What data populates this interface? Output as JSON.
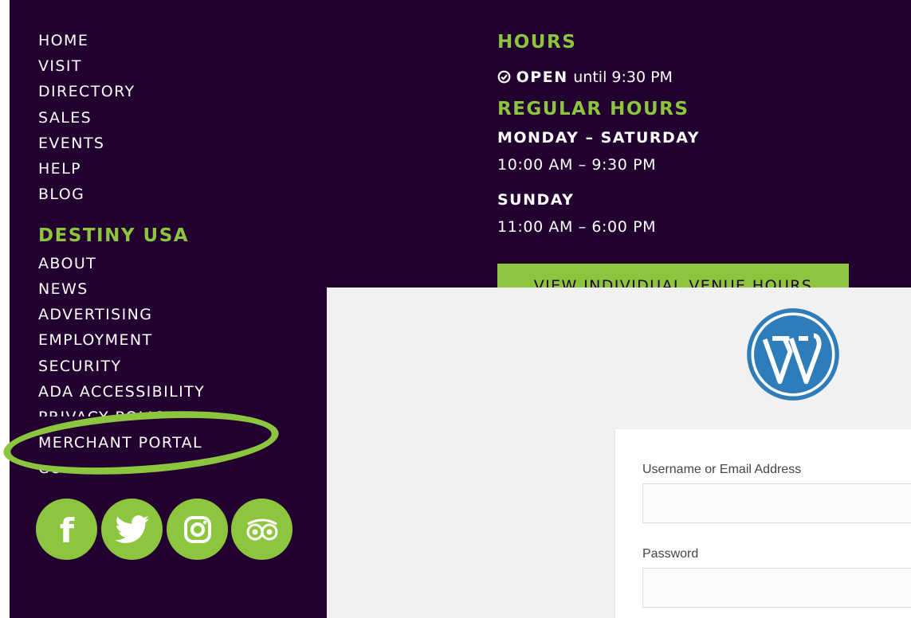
{
  "nav": {
    "main_links": [
      "HOME",
      "VISIT",
      "DIRECTORY",
      "SALES",
      "EVENTS",
      "HELP",
      "BLOG"
    ],
    "section_title": "DESTINY USA",
    "section_links": [
      "ABOUT",
      "NEWS",
      "ADVERTISING",
      "EMPLOYMENT",
      "SECURITY",
      "ADA ACCESSIBILITY"
    ],
    "partially_hidden_link": "PRIVACY POLICY",
    "highlighted_link": "MERCHANT PORTAL",
    "community_link": "COMMUNITY"
  },
  "social": [
    {
      "name": "facebook-icon",
      "glyph": "f"
    },
    {
      "name": "twitter-icon",
      "glyph": "twitter"
    },
    {
      "name": "instagram-icon",
      "glyph": "instagram"
    },
    {
      "name": "tripadvisor-icon",
      "glyph": "tripadvisor"
    }
  ],
  "hours": {
    "title": "HOURS",
    "open_status": "OPEN",
    "open_until": "until 9:30 PM",
    "regular_title": "REGULAR HOURS",
    "weekday_label": "MONDAY – SATURDAY",
    "weekday_hours": "10:00 AM – 9:30 PM",
    "sunday_label": "SUNDAY",
    "sunday_hours": "11:00 AM – 6:00 PM",
    "venue_button": "VIEW INDIVIDUAL VENUE HOURS"
  },
  "login": {
    "username_label": "Username or Email Address",
    "username_value": "",
    "password_label": "Password",
    "password_value": ""
  },
  "colors": {
    "background": "#220030",
    "accent": "#8cc63f",
    "wp_blue": "#2f7cba",
    "panel": "#f1f1f1"
  }
}
